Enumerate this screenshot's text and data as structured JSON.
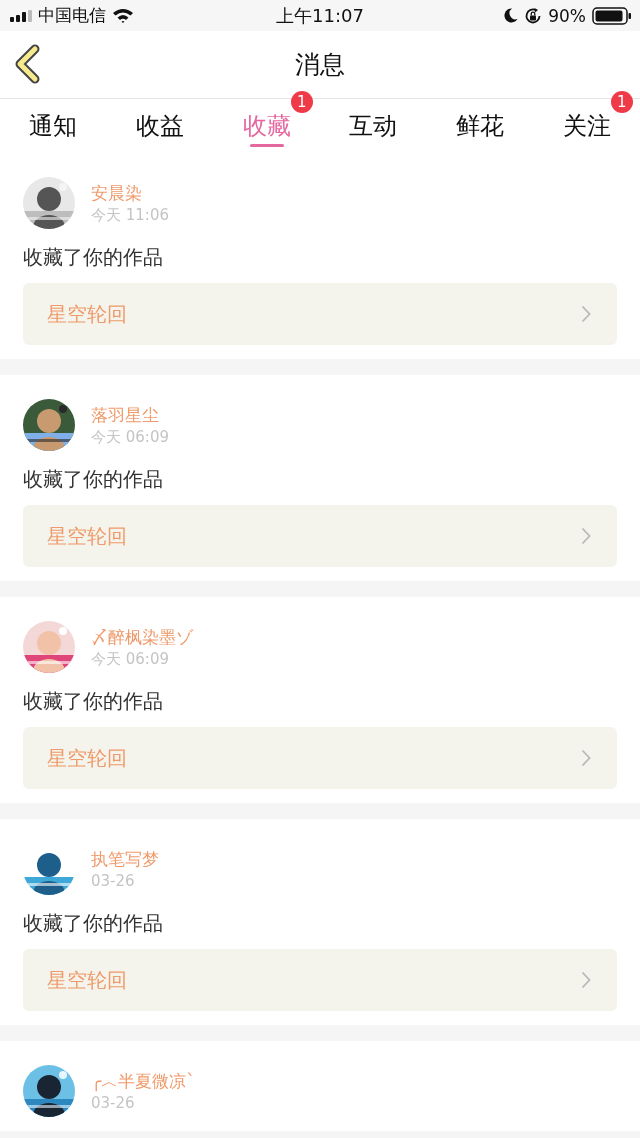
{
  "status_bar": {
    "carrier": "中国电信",
    "time": "上午11:07",
    "battery": "90%"
  },
  "header": {
    "title": "消息"
  },
  "tabs": [
    {
      "label": "通知",
      "selected": false
    },
    {
      "label": "收益",
      "selected": false
    },
    {
      "label": "收藏",
      "selected": true,
      "badge": "1"
    },
    {
      "label": "互动",
      "selected": false
    },
    {
      "label": "鲜花",
      "selected": false
    },
    {
      "label": "关注",
      "selected": false,
      "badge": "1"
    }
  ],
  "messages": [
    {
      "user": "安晨染",
      "time": "今天 11:06",
      "text": "收藏了你的作品",
      "work": "星空轮回"
    },
    {
      "user": "落羽星尘",
      "time": "今天 06:09",
      "text": "收藏了你的作品",
      "work": "星空轮回"
    },
    {
      "user": "〆醉枫染墨ゾ",
      "time": "今天 06:09",
      "text": "收藏了你的作品",
      "work": "星空轮回"
    },
    {
      "user": "执笔写梦",
      "time": "03-26",
      "text": "收藏了你的作品",
      "work": "星空轮回"
    },
    {
      "user": "╭︿半夏微凉`",
      "time": "03-26"
    }
  ]
}
